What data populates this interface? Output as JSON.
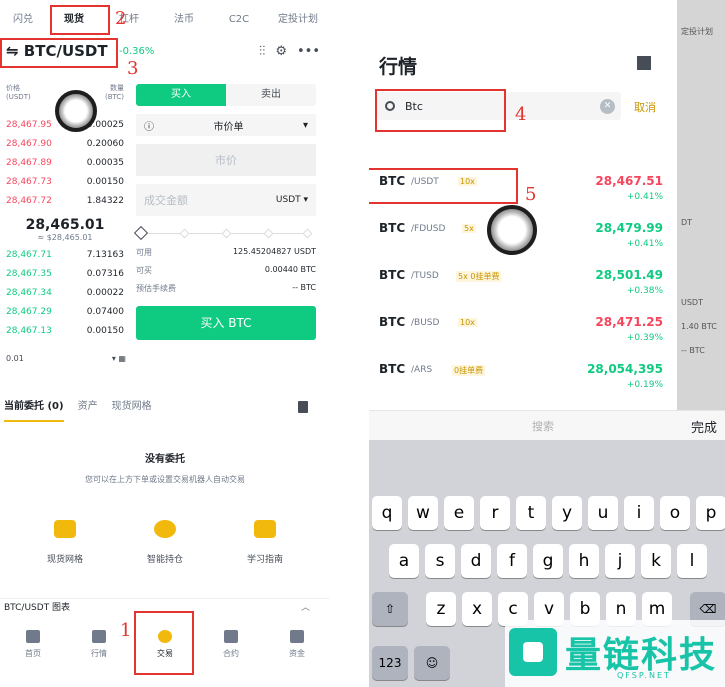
{
  "left": {
    "tabs": [
      "闪兑",
      "现货",
      "杠杆",
      "法币",
      "C2C",
      "定投计划"
    ],
    "pair": "⇋ BTC/USDT",
    "change": "-0.36%",
    "annotations": [
      "1",
      "2",
      "3"
    ],
    "orderbook": {
      "price_head": "价格\n(USDT)",
      "amount_head": "数量\n(BTC)",
      "asks": [
        {
          "p": "28,467.95",
          "a": "0.00025"
        },
        {
          "p": "28,467.90",
          "a": "0.20060"
        },
        {
          "p": "28,467.89",
          "a": "0.00035"
        },
        {
          "p": "28,467.73",
          "a": "0.00150"
        },
        {
          "p": "28,467.72",
          "a": "1.84322"
        }
      ],
      "mid": "28,465.01",
      "mid_sub": "≈ $28,465.01",
      "bids": [
        {
          "p": "28,467.71",
          "a": "7.13163"
        },
        {
          "p": "28,467.35",
          "a": "0.07316"
        },
        {
          "p": "28,467.34",
          "a": "0.00022"
        },
        {
          "p": "28,467.29",
          "a": "0.07400"
        },
        {
          "p": "28,467.13",
          "a": "0.00150"
        }
      ],
      "depth": "0.01"
    },
    "form": {
      "buy": "买入",
      "sell": "卖出",
      "order_type": "市价单",
      "price_ph": "市价",
      "amount_ph": "成交金额",
      "amount_unit": "USDT ▾",
      "available_k": "可用",
      "available_v": "125.45204827 USDT",
      "can_buy_k": "可买",
      "can_buy_v": "0.00440 BTC",
      "fee_k": "预估手续费",
      "fee_v": "-- BTC",
      "buy_btn": "买入 BTC"
    },
    "orders_tabs": [
      "当前委托 (0)",
      "资产",
      "现货网格"
    ],
    "empty_title": "没有委托",
    "empty_sub": "您可以在上方下单或设置交易机器人自动交易",
    "tools": [
      "现货网格",
      "智能持仓",
      "学习指南"
    ],
    "chart_bar": "BTC/USDT 图表",
    "nav": [
      "首页",
      "行情",
      "交易",
      "合约",
      "资金"
    ]
  },
  "right": {
    "title": "行情",
    "search_value": "Btc",
    "cancel": "取消",
    "annotations": [
      "4",
      "5"
    ],
    "markets": [
      {
        "base": "BTC",
        "quote": "/USDT",
        "tag": "10x",
        "price": "28,467.51",
        "change": "+0.41%",
        "dir": "down"
      },
      {
        "base": "BTC",
        "quote": "/FDUSD",
        "tag": "5x",
        "price": "28,479.99",
        "change": "+0.41%",
        "dir": "up"
      },
      {
        "base": "BTC",
        "quote": "/TUSD",
        "tag": "5x  0挂单费",
        "price": "28,501.49",
        "change": "+0.38%",
        "dir": "up"
      },
      {
        "base": "BTC",
        "quote": "/BUSD",
        "tag": "10x",
        "price": "28,471.25",
        "change": "+0.39%",
        "dir": "down"
      },
      {
        "base": "BTC",
        "quote": "/ARS",
        "tag": "0挂单费",
        "price": "28,054,395",
        "change": "+0.19%",
        "dir": "up"
      }
    ],
    "bg_texts": [
      "定投计划",
      "DT",
      "USDT",
      "1.40 BTC",
      "-- BTC"
    ],
    "kb_placeholder": "搜索",
    "kb_done": "完成",
    "kb_rows": [
      [
        "q",
        "w",
        "e",
        "r",
        "t",
        "y",
        "u",
        "i",
        "o",
        "p"
      ],
      [
        "a",
        "s",
        "d",
        "f",
        "g",
        "h",
        "j",
        "k",
        "l"
      ],
      [
        "z",
        "x",
        "c",
        "v",
        "b",
        "n",
        "m"
      ]
    ],
    "kb_num": "123"
  },
  "watermark": {
    "text": "量链科技",
    "sub": "QFSP.NET"
  },
  "colors": {
    "green": "#0ecb81",
    "red": "#f6465d",
    "yellow": "#f0b90b",
    "annot": "#e3342f"
  }
}
